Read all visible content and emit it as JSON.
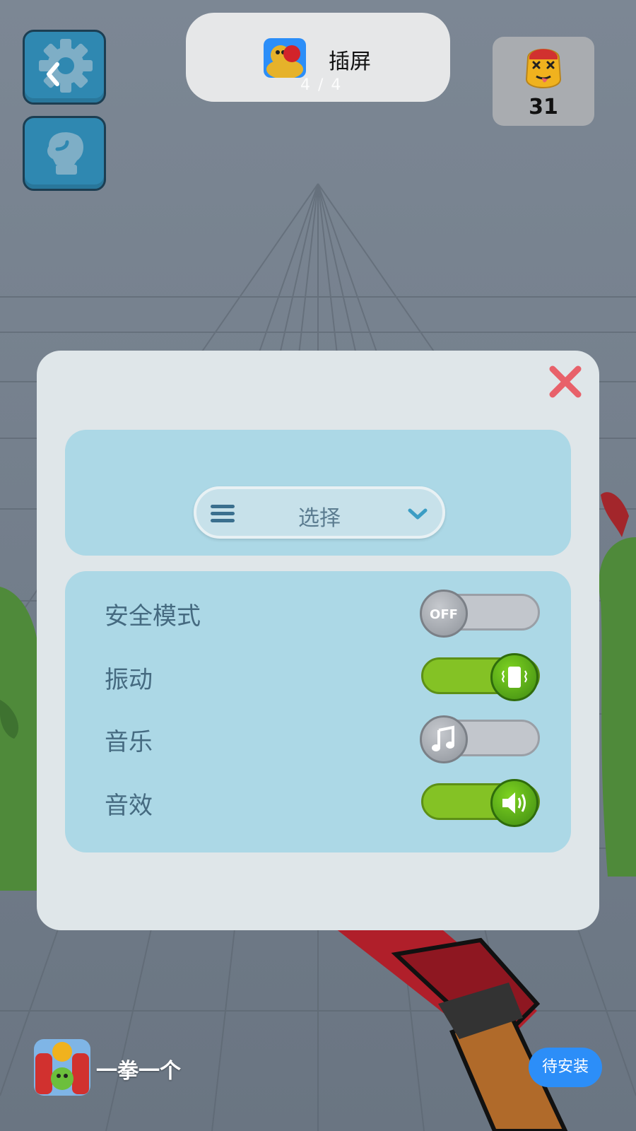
{
  "ad": {
    "title": "插屏",
    "counter": "4 / 4",
    "app_icon": "game-app-icon"
  },
  "score": {
    "value": "31",
    "icon": "dizzy-face-icon"
  },
  "settings": {
    "select_label": "选择",
    "rows": [
      {
        "label": "安全模式",
        "state": "off",
        "knob": "OFF"
      },
      {
        "label": "振动",
        "state": "on",
        "knob": "vibrate-icon"
      },
      {
        "label": "音乐",
        "state": "off",
        "knob": "music-note-icon"
      },
      {
        "label": "音效",
        "state": "on",
        "knob": "speaker-icon"
      }
    ]
  },
  "bottom_ad": {
    "app_name": "一拳一个",
    "install_label": "待安装"
  },
  "colors": {
    "toggle_on": "#84c225",
    "toggle_off": "#c2c6cc",
    "close": "#e8616a",
    "install": "#2c8ef8"
  }
}
